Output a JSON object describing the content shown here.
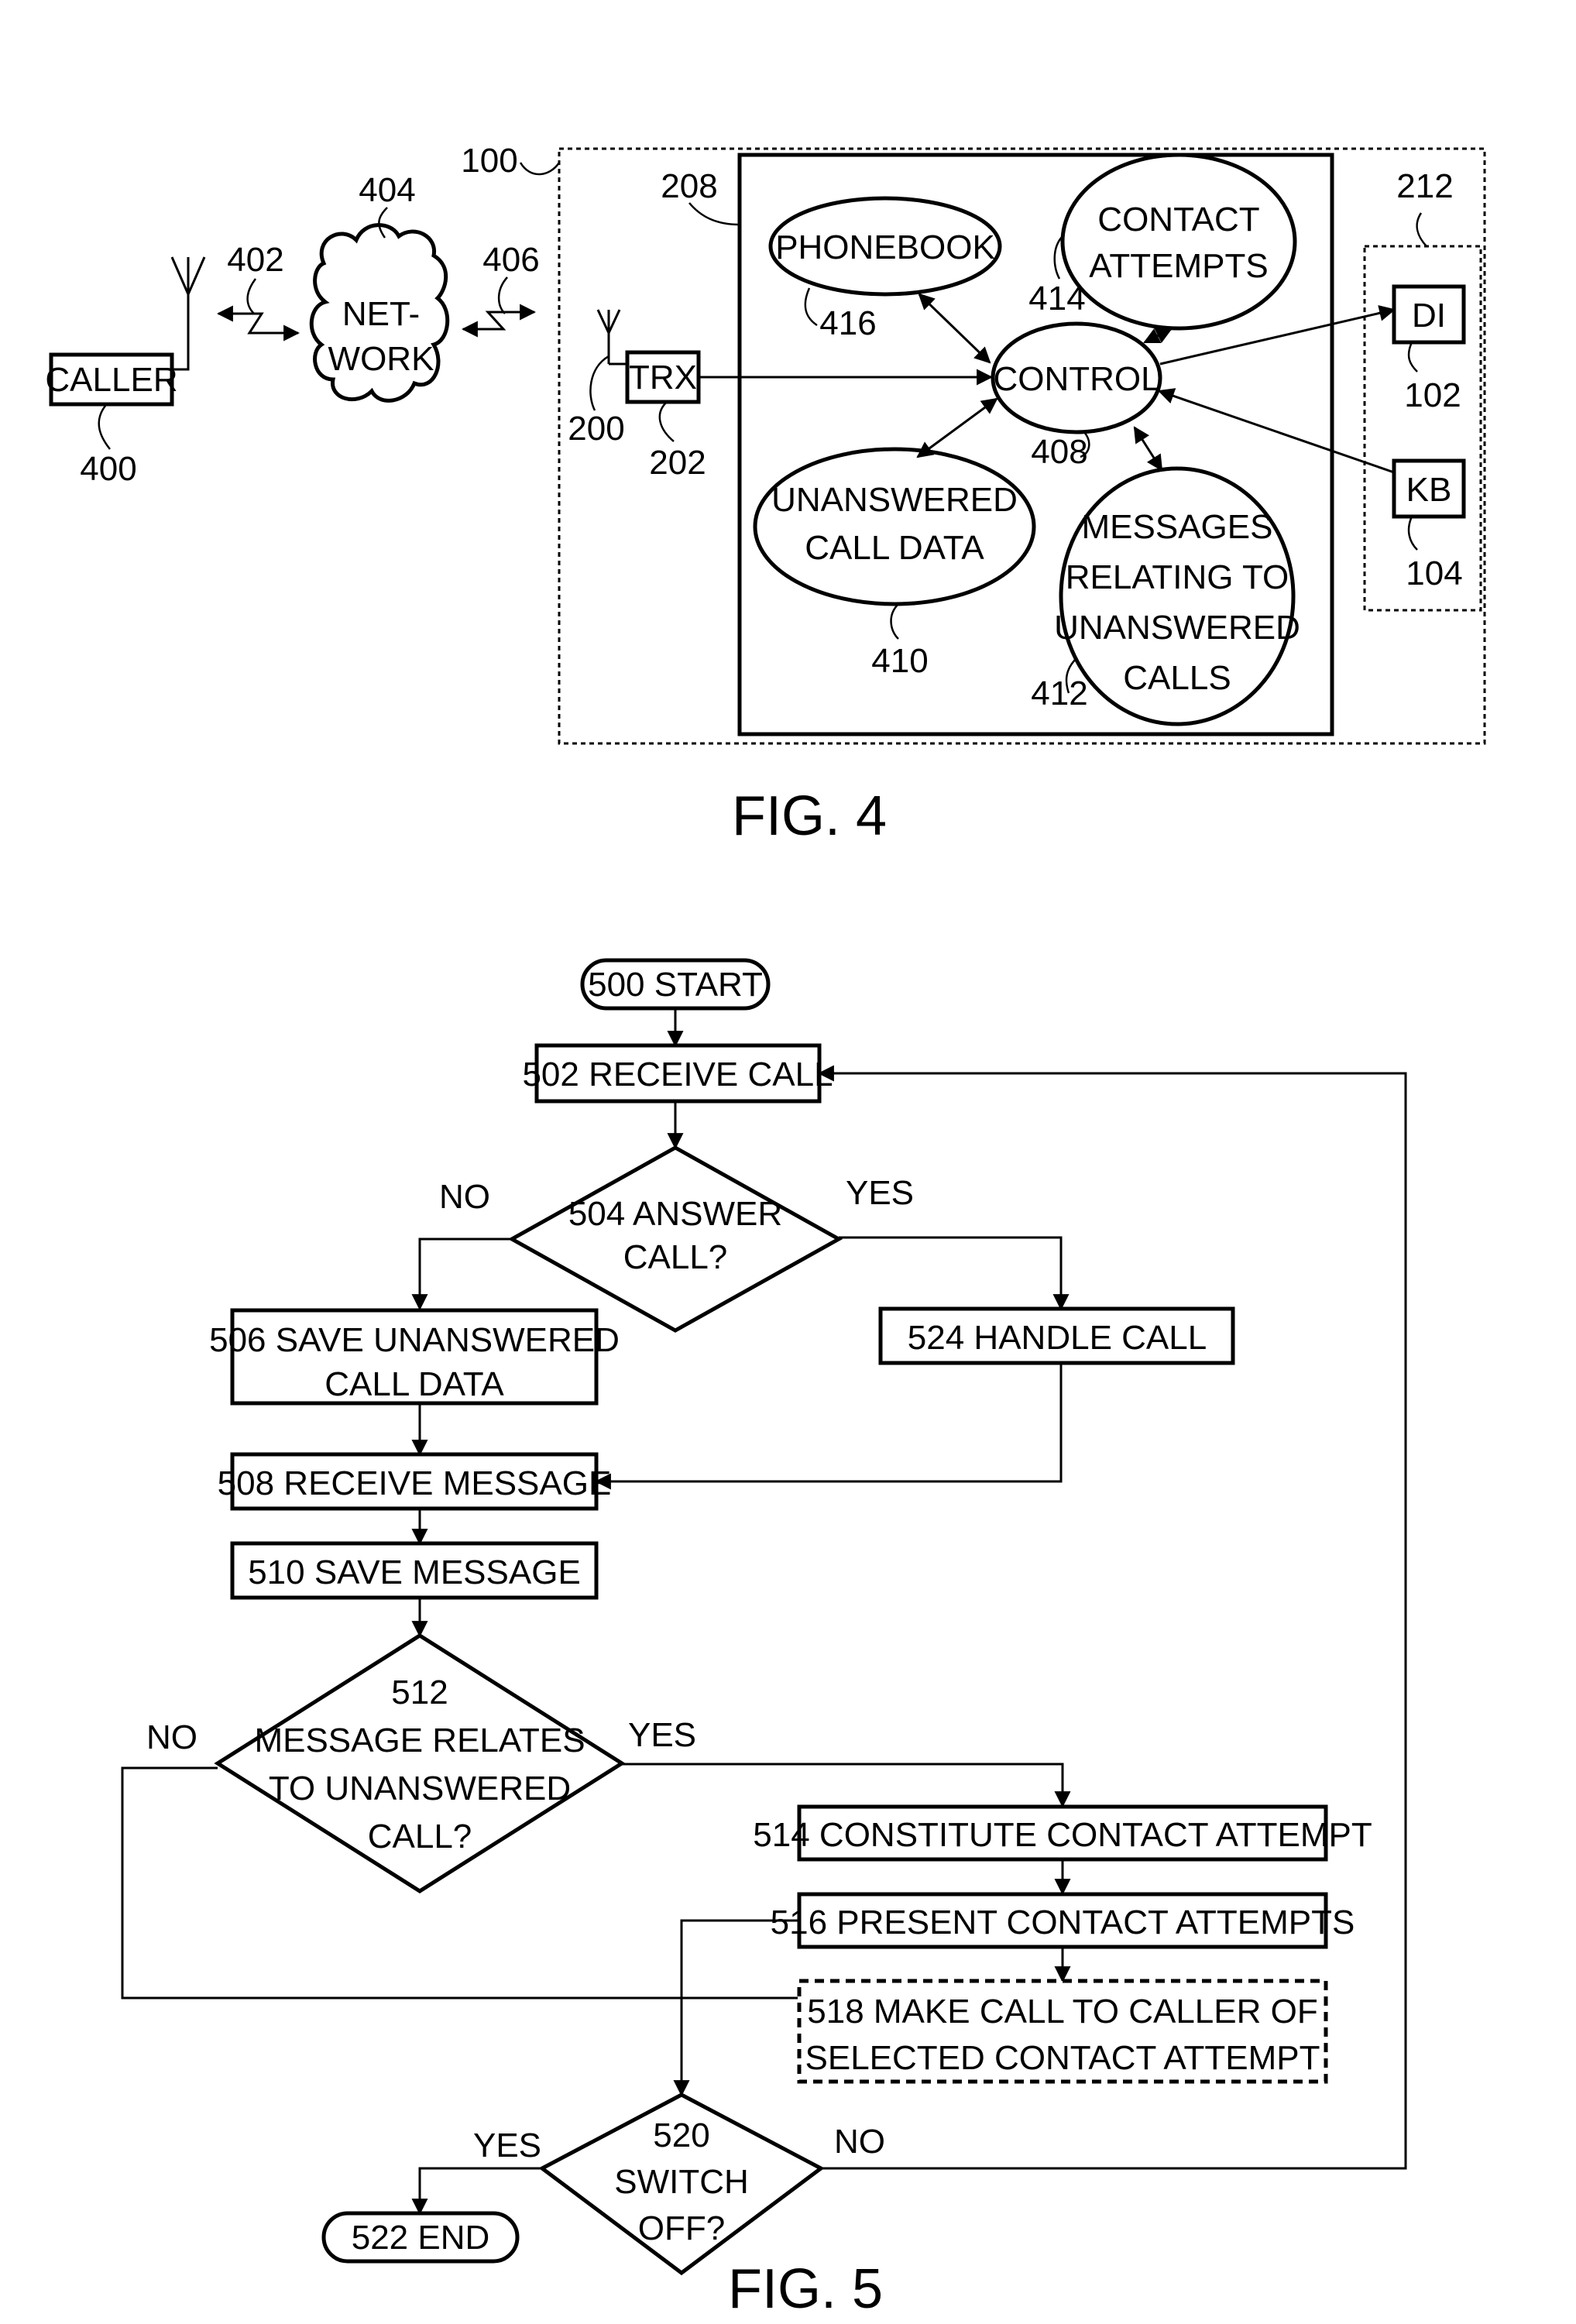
{
  "fig4": {
    "title": "FIG. 4",
    "caller": {
      "label": "CALLER",
      "ref": "400"
    },
    "link_402": "402",
    "network": {
      "line1": "NET-",
      "line2": "WORK",
      "ref": "404"
    },
    "link_406": "406",
    "device_ref": "100",
    "antenna_ref": "200",
    "trx": {
      "label": "TRX",
      "ref": "202"
    },
    "memory_ref": "208",
    "phonebook": {
      "label": "PHONEBOOK",
      "ref": "416"
    },
    "contact_attempts": {
      "line1": "CONTACT",
      "line2": "ATTEMPTS",
      "ref": "414"
    },
    "control": {
      "label": "CONTROL",
      "ref": "408"
    },
    "unanswered_call_data": {
      "line1": "UNANSWERED",
      "line2": "CALL DATA",
      "ref": "410"
    },
    "messages": {
      "line1": "MESSAGES",
      "line2": "RELATING TO",
      "line3": "UNANSWERED",
      "line4": "CALLS",
      "ref": "412"
    },
    "ui_ref": "212",
    "display": {
      "label": "DI",
      "ref": "102"
    },
    "keyboard": {
      "label": "KB",
      "ref": "104"
    }
  },
  "fig5": {
    "title": "FIG. 5",
    "start": "500 START",
    "receive_call": "502 RECEIVE CALL",
    "answer_call": {
      "line1": "504 ANSWER",
      "line2": "CALL?"
    },
    "answer_no": "NO",
    "answer_yes": "YES",
    "save_unanswered": {
      "line1": "506 SAVE UNANSWERED",
      "line2": "CALL DATA"
    },
    "handle_call": "524 HANDLE CALL",
    "receive_message": "508 RECEIVE MESSAGE",
    "save_message": "510 SAVE MESSAGE",
    "relates": {
      "line1": "512",
      "line2": "MESSAGE RELATES",
      "line3": "TO UNANSWERED",
      "line4": "CALL?"
    },
    "relates_no": "NO",
    "relates_yes": "YES",
    "constitute": "514 CONSTITUTE CONTACT ATTEMPT",
    "present": "516 PRESENT CONTACT ATTEMPTS",
    "make_call": {
      "line1": "518 MAKE CALL TO CALLER OF",
      "line2": "SELECTED CONTACT ATTEMPT"
    },
    "switch_off": {
      "line1": "520",
      "line2": "SWITCH",
      "line3": "OFF?"
    },
    "switch_yes": "YES",
    "switch_no": "NO",
    "end": "522 END"
  }
}
